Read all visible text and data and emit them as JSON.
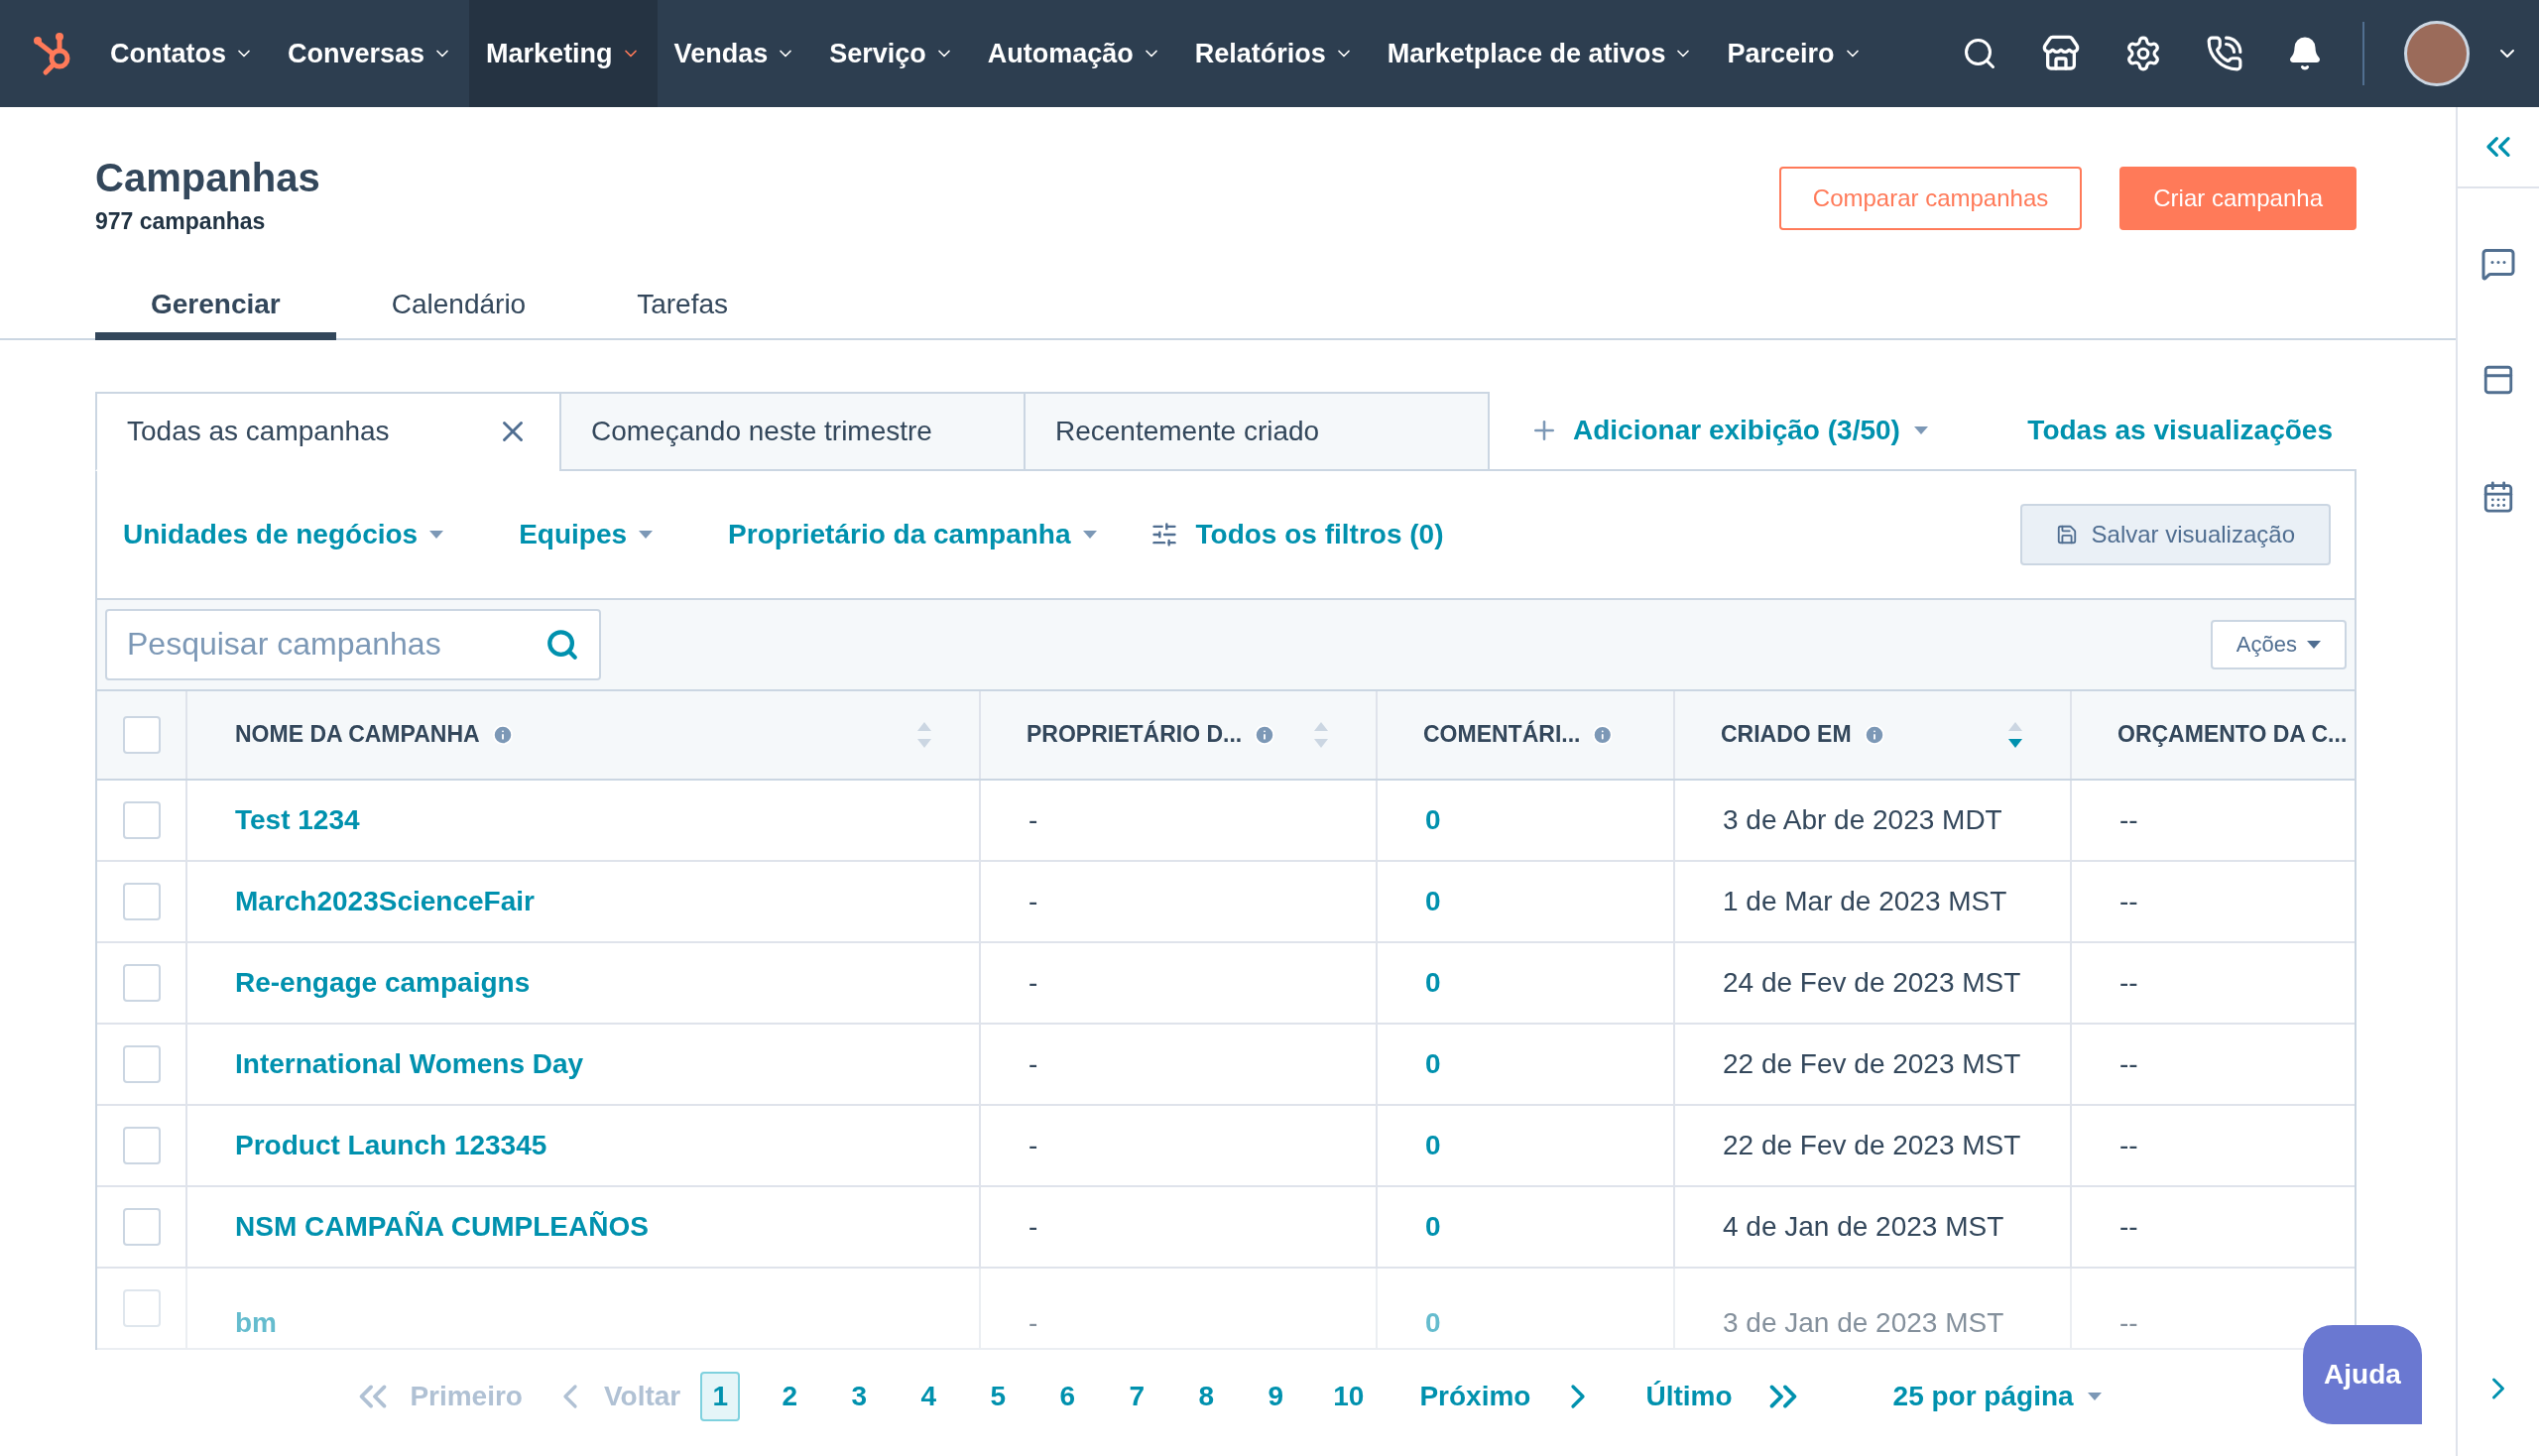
{
  "nav": {
    "items": [
      {
        "label": "Contatos",
        "selected": false
      },
      {
        "label": "Conversas",
        "selected": false
      },
      {
        "label": "Marketing",
        "selected": true
      },
      {
        "label": "Vendas",
        "selected": false
      },
      {
        "label": "Serviço",
        "selected": false
      },
      {
        "label": "Automação",
        "selected": false
      },
      {
        "label": "Relatórios",
        "selected": false
      },
      {
        "label": "Marketplace de ativos",
        "selected": false
      },
      {
        "label": "Parceiro",
        "selected": false
      }
    ]
  },
  "header": {
    "title": "Campanhas",
    "count": "977 campanhas",
    "buttons": [
      {
        "label": "Comparar campanhas",
        "kind": "outline"
      },
      {
        "label": "Criar campanha",
        "kind": "primary"
      }
    ]
  },
  "tabs": [
    {
      "label": "Gerenciar",
      "selected": true
    },
    {
      "label": "Calendário",
      "selected": false
    },
    {
      "label": "Tarefas",
      "selected": false
    }
  ],
  "views": {
    "tabs": [
      {
        "label": "Todas as campanhas",
        "selected": true
      },
      {
        "label": "Começando neste trimestre",
        "selected": false
      },
      {
        "label": "Recentemente criado",
        "selected": false
      }
    ],
    "add": "Adicionar exibição (3/50)",
    "all": "Todas as visualizações"
  },
  "filters": {
    "items": [
      {
        "label": "Unidades de negócios",
        "kind": "dropdown"
      },
      {
        "label": "Equipes",
        "kind": "dropdown"
      },
      {
        "label": "Proprietário da campanha",
        "kind": "dropdown"
      },
      {
        "label": "Todos os filtros (0)",
        "kind": "all"
      }
    ],
    "save": "Salvar visualização"
  },
  "search": {
    "placeholder": "Pesquisar campanhas"
  },
  "actions": "Ações",
  "table": {
    "select_all_checked": false,
    "columns": [
      {
        "label": "NOME DA CAMPANHA",
        "info": true,
        "sortable": true,
        "sorted": false
      },
      {
        "label": "PROPRIETÁRIO D...",
        "info": true,
        "sortable": true,
        "sorted": false
      },
      {
        "label": "COMENTÁRI...",
        "info": true,
        "sortable": false,
        "sorted": false
      },
      {
        "label": "CRIADO EM",
        "info": true,
        "sortable": true,
        "sorted": true
      },
      {
        "label": "ORÇAMENTO DA C...",
        "info": false,
        "sortable": false,
        "sorted": false
      }
    ],
    "rows": [
      {
        "checked": false,
        "cells": [
          "Test 1234",
          "-",
          "0",
          "3 de Abr de 2023 MDT",
          "--"
        ]
      },
      {
        "checked": false,
        "cells": [
          "March2023ScienceFair",
          "-",
          "0",
          "1 de Mar de 2023 MST",
          "--"
        ]
      },
      {
        "checked": false,
        "cells": [
          "Re-engage campaigns",
          "-",
          "0",
          "24 de Fev de 2023 MST",
          "--"
        ]
      },
      {
        "checked": false,
        "cells": [
          "International Womens Day",
          "-",
          "0",
          "22 de Fev de 2023 MST",
          "--"
        ]
      },
      {
        "checked": false,
        "cells": [
          "Product Launch 123345",
          "-",
          "0",
          "22 de Fev de 2023 MST",
          "--"
        ]
      },
      {
        "checked": false,
        "cells": [
          "NSM CAMPAÑA CUMPLEAÑOS",
          "-",
          "0",
          "4 de Jan de 2023 MST",
          "--"
        ]
      },
      {
        "checked": false,
        "cells": [
          "bm",
          "-",
          "0",
          "3 de Jan de 2023 MST",
          "--"
        ]
      }
    ]
  },
  "pagination": {
    "first": {
      "label": "Primeiro",
      "disabled": true
    },
    "prev": {
      "label": "Voltar",
      "disabled": true
    },
    "pages": [
      {
        "label": "1",
        "selected": true
      },
      {
        "label": "2",
        "selected": false
      },
      {
        "label": "3",
        "selected": false
      },
      {
        "label": "4",
        "selected": false
      },
      {
        "label": "5",
        "selected": false
      },
      {
        "label": "6",
        "selected": false
      },
      {
        "label": "7",
        "selected": false
      },
      {
        "label": "8",
        "selected": false
      },
      {
        "label": "9",
        "selected": false
      },
      {
        "label": "10",
        "selected": false
      }
    ],
    "next": {
      "label": "Próximo",
      "disabled": false
    },
    "last": {
      "label": "Último",
      "disabled": false
    },
    "per_page": "25 por página"
  },
  "help": "Ajuda"
}
